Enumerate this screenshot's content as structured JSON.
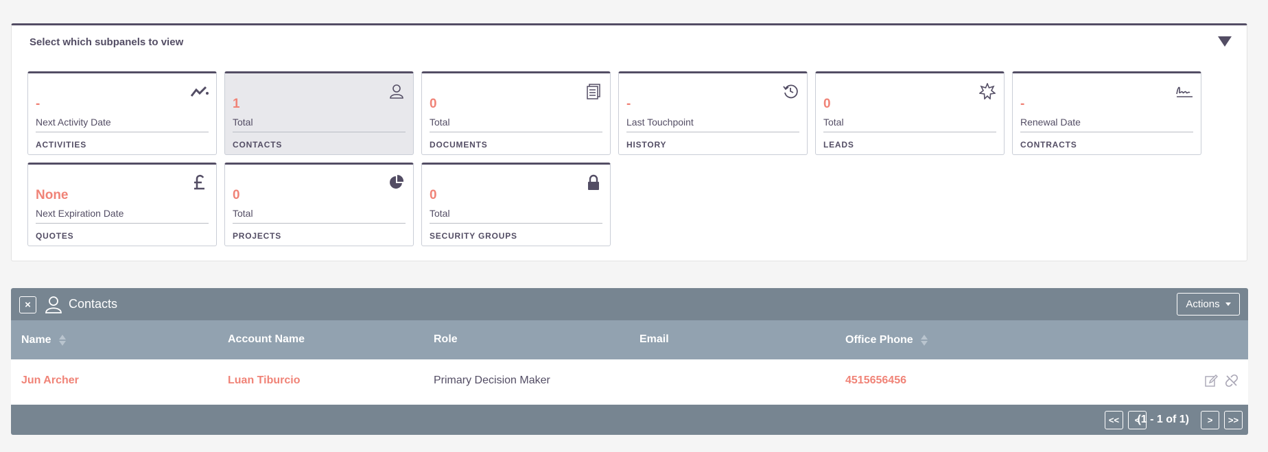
{
  "subpanel_selector": {
    "title": "Select which subpanels to view",
    "tiles": [
      {
        "value": "-",
        "label": "Next Activity Date",
        "name": "ACTIVITIES",
        "icon": "activity-trend-icon",
        "active": false
      },
      {
        "value": "1",
        "label": "Total",
        "name": "CONTACTS",
        "icon": "person-icon",
        "active": true
      },
      {
        "value": "0",
        "label": "Total",
        "name": "DOCUMENTS",
        "icon": "document-icon",
        "active": false
      },
      {
        "value": "-",
        "label": "Last Touchpoint",
        "name": "HISTORY",
        "icon": "history-icon",
        "active": false
      },
      {
        "value": "0",
        "label": "Total",
        "name": "LEADS",
        "icon": "badge-star-icon",
        "active": false
      },
      {
        "value": "-",
        "label": "Renewal Date",
        "name": "CONTRACTS",
        "icon": "signature-icon",
        "active": false
      },
      {
        "value": "None",
        "label": "Next Expiration Date",
        "name": "QUOTES",
        "icon": "pound-sign-icon",
        "active": false
      },
      {
        "value": "0",
        "label": "Total",
        "name": "PROJECTS",
        "icon": "pie-chart-icon",
        "active": false
      },
      {
        "value": "0",
        "label": "Total",
        "name": "SECURITY GROUPS",
        "icon": "lock-icon",
        "active": false
      }
    ]
  },
  "contacts_panel": {
    "close_label": "×",
    "title": "Contacts",
    "actions_label": "Actions",
    "columns": {
      "name": "Name",
      "account_name": "Account Name",
      "role": "Role",
      "email": "Email",
      "office_phone": "Office Phone"
    },
    "rows": [
      {
        "name": "Jun Archer",
        "account_name": "Luan Tiburcio",
        "role": "Primary Decision Maker",
        "email": "",
        "office_phone": "4515656456"
      }
    ],
    "pagination": {
      "first": "<<",
      "prev": "<",
      "count": "(1 - 1 of 1)",
      "next": ">",
      "last": ">>"
    }
  },
  "colors": {
    "accent": "#f08377",
    "text": "#534d64",
    "header_bg": "#778591",
    "column_header_bg": "#92a2b0"
  }
}
